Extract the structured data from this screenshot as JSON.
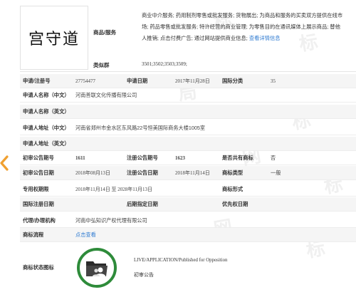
{
  "mark": {
    "image_text": "宫守道",
    "goods_label": "商品/服务",
    "goods_text": "商业中介服务; 药用制剂零售或批发服务; 货物展出; 为商品和服务的买卖双方提供在线市场; 药品零售或批发服务; 特许经营的商业管理; 为零售目的在通讯媒体上展示商品; 替他人推销; 点击付费广告; 通过网站提供商业信息; ",
    "more_link": "查看详情信息",
    "similar_label": "类似群",
    "similar_value": "3501;3502;3503;3509;"
  },
  "fields": {
    "app_no_label": "申请/注册号",
    "app_no": "27754477",
    "app_date_label": "申请日期",
    "app_date": "2017年11月28日",
    "class_label": "国际分类",
    "class_value": "35",
    "applicant_cn_label": "申请人名称（中文）",
    "applicant_cn": "河南善联文化传播有限公司",
    "applicant_en_label": "申请人名称（英文）",
    "applicant_en": "",
    "address_cn_label": "申请人地址（中文）",
    "address_cn": "河南省郑州市金水区东风路22号恒美国际商务大楼1005室",
    "address_en_label": "申请人地址（英文）",
    "address_en": "",
    "prelim_no_label": "初审公告期号",
    "prelim_no": "1611",
    "reg_no_label": "注册公告期号",
    "reg_no": "1623",
    "shared_label": "是否共有商标",
    "shared_value": "否",
    "prelim_date_label": "初审公告日期",
    "prelim_date": "2018年08月13日",
    "reg_date_label": "注册公告日期",
    "reg_date": "2018年11月14日",
    "type_label": "商标类型",
    "type_value": "一般",
    "exclusive_label": "专用权期限",
    "exclusive_value": "2018年11月14日 至 2028年11月13日",
    "form_label": "商标形式",
    "form_value": "",
    "intl_reg_date_label": "国际注册日期",
    "intl_reg_date": "",
    "later_date_label": "后期指定日期",
    "later_date": "",
    "priority_label": "优先权日期",
    "priority_value": "",
    "agent_label": "代理/办理机构",
    "agent_value": "河南中弘知识产权代理有限公司",
    "flow_label": "商标流程",
    "flow_link": "点击查看",
    "status_label": "商标状态图标",
    "status_en": "LIVE/APPLICATION/Published for Opposition",
    "status_cn": "初审公告"
  },
  "colors": {
    "link": "#2f7bd1",
    "status_green": "#2e8b3a",
    "arrow_orange": "#f0a030"
  },
  "icons": {
    "left_nav": "chevron-left-icon",
    "status": "folder-users-icon"
  }
}
